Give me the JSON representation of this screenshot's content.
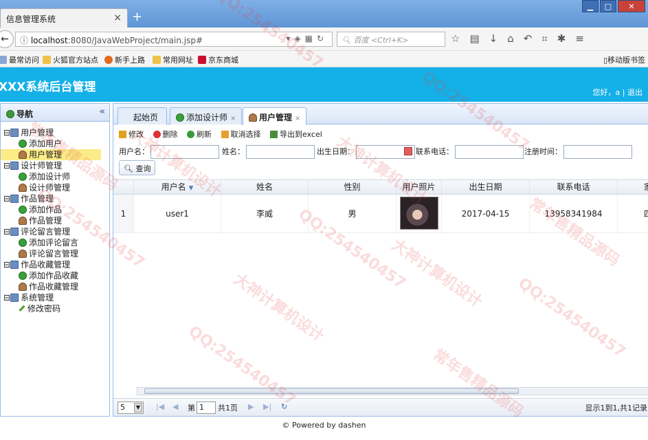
{
  "browser": {
    "tab_title": "信息管理系统",
    "tab_close": "×",
    "new_tab": "+",
    "url_host": "localhost",
    "url_rest": ":8080/JavaWebProject/main.jsp#",
    "search_placeholder": "百度 <Ctrl+K>",
    "window_min": "▁",
    "window_max": "□",
    "window_close": "✕"
  },
  "bookmarks": {
    "items": [
      "最常访问",
      "火狐官方站点",
      "新手上路",
      "常用网址",
      "京东商城"
    ],
    "mobile": "移动版书签"
  },
  "app": {
    "title": "XXX系统后台管理",
    "greeting": "您好，a | 退出"
  },
  "nav": {
    "title": "导航",
    "collapse": "«",
    "groups": [
      {
        "label": "用户管理",
        "children": [
          "添加用户",
          "用户管理"
        ]
      },
      {
        "label": "设计师管理",
        "children": [
          "添加设计师",
          "设计师管理"
        ]
      },
      {
        "label": "作品管理",
        "children": [
          "添加作品",
          "作品管理"
        ]
      },
      {
        "label": "评论留言管理",
        "children": [
          "添加评论留言",
          "评论留言管理"
        ]
      },
      {
        "label": "作品收藏管理",
        "children": [
          "添加作品收藏",
          "作品收藏管理"
        ]
      },
      {
        "label": "系统管理",
        "children": [
          "修改密码"
        ]
      }
    ]
  },
  "tabs": [
    {
      "label": "起始页"
    },
    {
      "label": "添加设计师"
    },
    {
      "label": "用户管理"
    }
  ],
  "toolbar": {
    "edit": "修改",
    "delete": "删除",
    "refresh": "刷新",
    "deselect": "取消选择",
    "export": "导出到excel"
  },
  "search": {
    "username": "用户名：",
    "name": "姓名：",
    "birthday": "出生日期：",
    "phone": "联系电话：",
    "regtime": "注册时间：",
    "query": "查询"
  },
  "grid": {
    "columns": [
      "用户名",
      "姓名",
      "性别",
      "用户照片",
      "出生日期",
      "联系电话",
      "家"
    ],
    "rows": [
      {
        "num": "1",
        "username": "user1",
        "name": "李威",
        "gender": "男",
        "birthday": "2017-04-15",
        "phone": "13958341984",
        "addr": "四"
      }
    ]
  },
  "pager": {
    "page_size": "5",
    "page_prefix": "第",
    "page_value": "1",
    "page_total": "共1页",
    "summary": "显示1到1,共1记录"
  },
  "footer": "© Powered by dashen",
  "watermark": {
    "qq": "QQ:254540457",
    "shen": "大神计算机设计",
    "chang": "常年售精品源码"
  }
}
